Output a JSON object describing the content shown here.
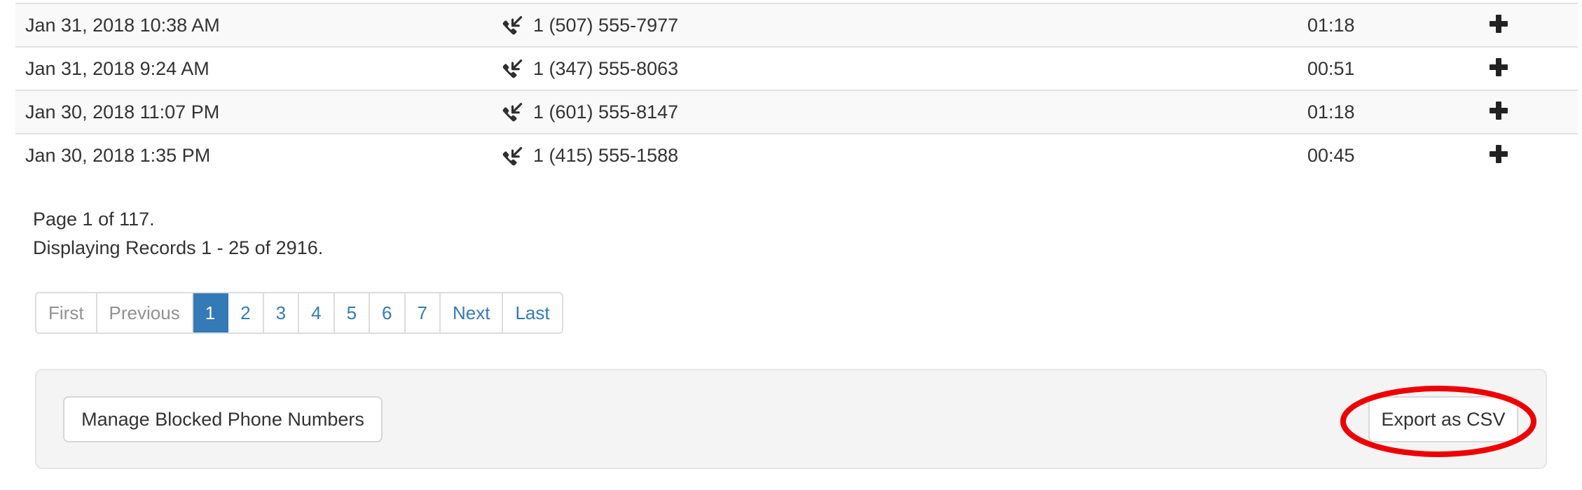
{
  "call_log": {
    "rows": [
      {
        "date": "Jan 31, 2018 10:38 AM",
        "icon": "incoming-call-icon",
        "phone": "1 (507) 555-7977",
        "duration": "01:18",
        "action_icon": "plus-icon"
      },
      {
        "date": "Jan 31, 2018 9:24 AM",
        "icon": "incoming-call-icon",
        "phone": "1 (347) 555-8063",
        "duration": "00:51",
        "action_icon": "plus-icon"
      },
      {
        "date": "Jan 30, 2018 11:07 PM",
        "icon": "incoming-call-icon",
        "phone": "1 (601) 555-8147",
        "duration": "01:18",
        "action_icon": "plus-icon"
      },
      {
        "date": "Jan 30, 2018 1:35 PM",
        "icon": "incoming-call-icon",
        "phone": "1 (415) 555-1588",
        "duration": "00:45",
        "action_icon": "plus-icon"
      }
    ]
  },
  "summary": {
    "page_info": "Page 1 of 117.",
    "record_info": "Displaying Records 1 - 25 of 2916."
  },
  "pagination": {
    "items": [
      {
        "label": "First",
        "state": "disabled"
      },
      {
        "label": "Previous",
        "state": "disabled"
      },
      {
        "label": "1",
        "state": "active"
      },
      {
        "label": "2",
        "state": "link"
      },
      {
        "label": "3",
        "state": "link"
      },
      {
        "label": "4",
        "state": "link"
      },
      {
        "label": "5",
        "state": "link"
      },
      {
        "label": "6",
        "state": "link"
      },
      {
        "label": "7",
        "state": "link"
      },
      {
        "label": "Next",
        "state": "link"
      },
      {
        "label": "Last",
        "state": "link"
      }
    ],
    "active_color": "#337ab7",
    "link_color": "#337ab7",
    "disabled_color": "#919191"
  },
  "actions": {
    "manage_blocked_label": "Manage Blocked Phone Numbers",
    "export_csv_label": "Export as CSV"
  },
  "annotation": {
    "shape": "ellipse",
    "color": "#ee0000",
    "target": "Export as CSV"
  }
}
